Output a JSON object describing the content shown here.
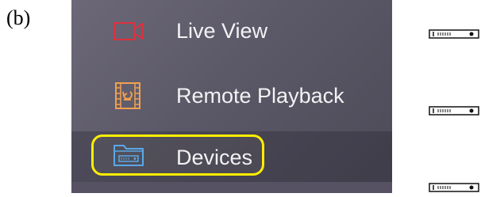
{
  "figure": {
    "label": "(b)"
  },
  "menu": {
    "items": [
      {
        "label": "Live View",
        "icon": "video-camera-icon",
        "icon_color": "#e0303e",
        "selected": false
      },
      {
        "label": "Remote Playback",
        "icon": "film-playback-icon",
        "icon_color": "#f0a050",
        "selected": false
      },
      {
        "label": "Devices",
        "icon": "device-folder-icon",
        "icon_color": "#5aa8e8",
        "selected": true
      }
    ],
    "highlight_color": "#ffee00"
  },
  "side_devices": [
    {
      "icon": "dvr-recorder-icon"
    },
    {
      "icon": "dvr-recorder-icon"
    },
    {
      "icon": "dvr-recorder-icon"
    }
  ]
}
